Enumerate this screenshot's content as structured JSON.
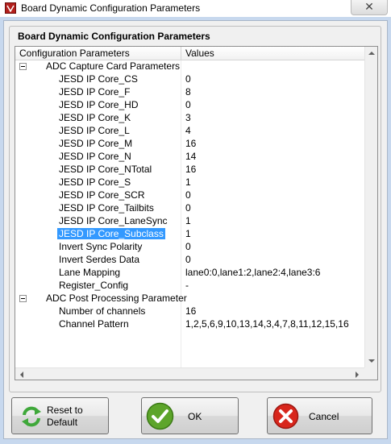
{
  "window": {
    "title": "Board Dynamic Configuration Parameters",
    "close_glyph": "✕"
  },
  "group": {
    "title": "Board Dynamic Configuration Parameters"
  },
  "tree": {
    "headers": {
      "name": "Configuration Parameters",
      "value": "Values"
    },
    "groups": [
      {
        "label": "ADC Capture Card Parameters",
        "expanded": true,
        "items": [
          {
            "name": "JESD IP Core_CS",
            "value": "0"
          },
          {
            "name": "JESD IP Core_F",
            "value": "8"
          },
          {
            "name": "JESD IP Core_HD",
            "value": "0"
          },
          {
            "name": "JESD IP Core_K",
            "value": "3"
          },
          {
            "name": "JESD IP Core_L",
            "value": "4"
          },
          {
            "name": "JESD IP Core_M",
            "value": "16"
          },
          {
            "name": "JESD IP Core_N",
            "value": "14"
          },
          {
            "name": "JESD IP Core_NTotal",
            "value": "16"
          },
          {
            "name": "JESD IP Core_S",
            "value": "1"
          },
          {
            "name": "JESD IP Core_SCR",
            "value": "0"
          },
          {
            "name": "JESD IP Core_Tailbits",
            "value": "0"
          },
          {
            "name": "JESD IP Core_LaneSync",
            "value": "1"
          },
          {
            "name": "JESD IP Core_Subclass",
            "value": "1",
            "selected": true
          },
          {
            "name": "Invert Sync Polarity",
            "value": "0"
          },
          {
            "name": "Invert Serdes Data",
            "value": "0"
          },
          {
            "name": "Lane Mapping",
            "value": "lane0:0,lane1:2,lane2:4,lane3:6"
          },
          {
            "name": "Register_Config",
            "value": "-"
          }
        ]
      },
      {
        "label": "ADC Post Processing Parameter",
        "expanded": true,
        "items": [
          {
            "name": "Number of channels",
            "value": "16"
          },
          {
            "name": "Channel Pattern",
            "value": "1,2,5,6,9,10,13,14,3,4,7,8,11,12,15,16"
          }
        ]
      }
    ]
  },
  "buttons": {
    "reset": {
      "line1": "Reset to",
      "line2": "Default",
      "icon": "refresh-icon"
    },
    "ok": {
      "label": "OK",
      "icon": "check-icon"
    },
    "cancel": {
      "label": "Cancel",
      "icon": "cancel-x-icon"
    }
  },
  "colors": {
    "selection": "#3399ff",
    "ok_green": "#5da52a",
    "cancel_red": "#d8261c",
    "reset_green": "#3fa83a"
  }
}
